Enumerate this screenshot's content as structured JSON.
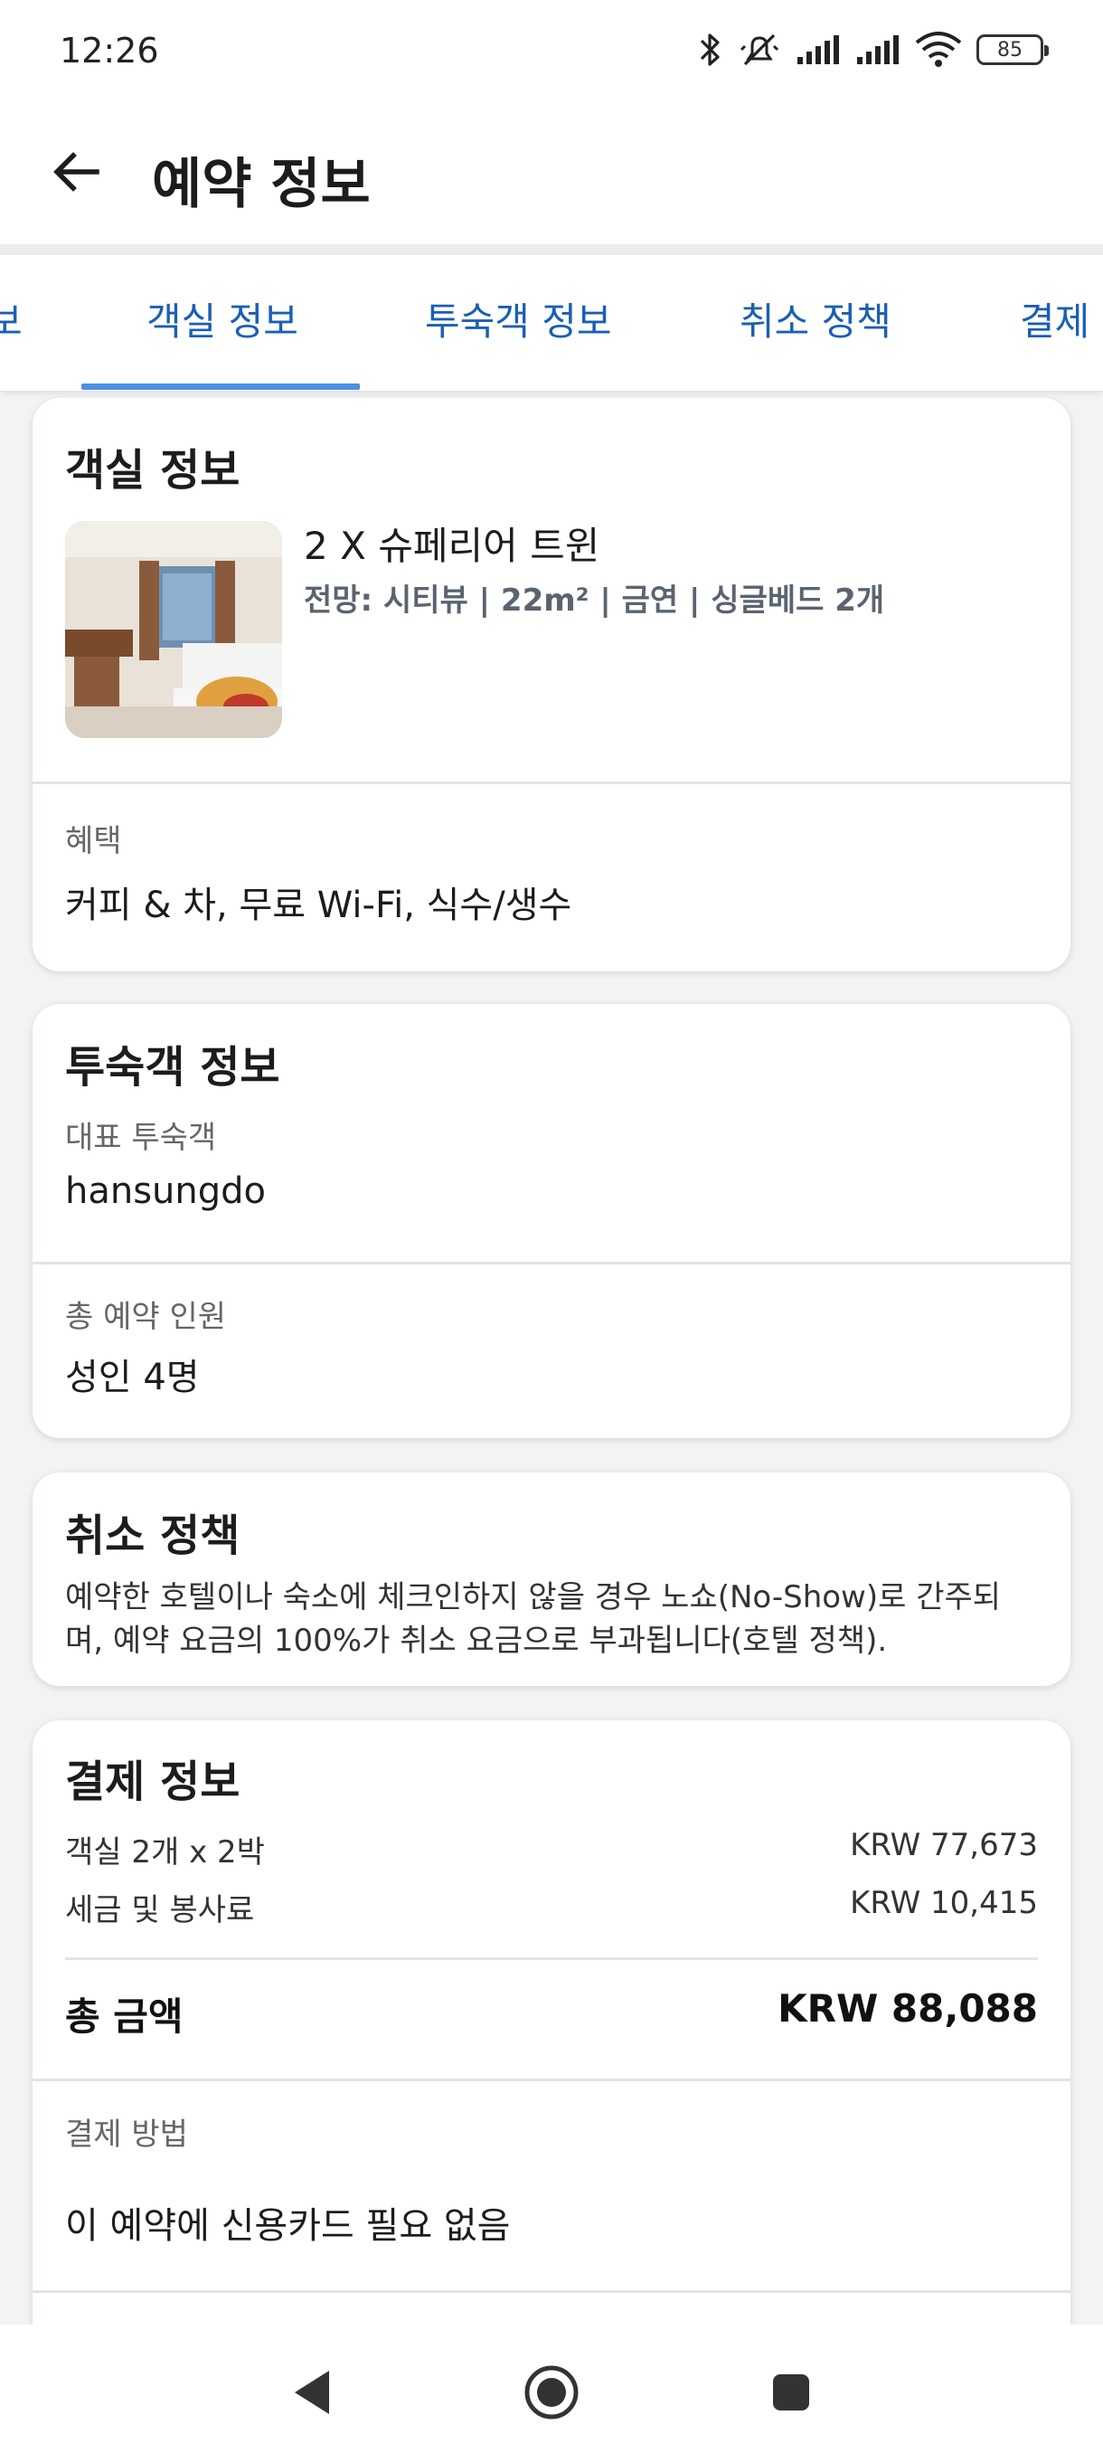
{
  "status_bar": {
    "time": "12:26",
    "battery": "85",
    "icons": [
      "bluetooth-icon",
      "mute-icon",
      "signal-icon",
      "signal-icon",
      "wifi-icon",
      "battery-icon"
    ]
  },
  "header": {
    "title": "예약 정보",
    "back_icon": "arrow-left-icon"
  },
  "tabs": [
    {
      "label": "보"
    },
    {
      "label": "객실 정보",
      "active": true
    },
    {
      "label": "투숙객 정보"
    },
    {
      "label": "취소 정책"
    },
    {
      "label": "결제 정"
    }
  ],
  "room": {
    "title": "객실 정보",
    "name": "2 X 슈페리어 트윈",
    "details": "전망: 시티뷰 | 22m² | 금연 | 싱글베드 2개",
    "benefits_label": "혜택",
    "benefits": "커피 & 차, 무료 Wi-Fi, 식수/생수"
  },
  "guest": {
    "title": "투숙객 정보",
    "lead_label": "대표 투숙객",
    "lead_value": "hansungdo",
    "count_label": "총 예약 인원",
    "count_value": "성인 4명"
  },
  "cancel": {
    "title": "취소 정책",
    "line1": "예약한 호텔이나 숙소에 체크인하지 않을 경우 노쇼(No-Show)로 간주되",
    "line2": "며, 예약 요금의 100%가 취소 요금으로 부과됩니다(호텔 정책)."
  },
  "payment": {
    "title": "결제 정보",
    "rows": [
      {
        "label": "객실 2개 x 2박",
        "value": "KRW 77,673"
      },
      {
        "label": "세금 및 봉사료",
        "value": "KRW 10,415"
      }
    ],
    "total_label": "총 금액",
    "total_value": "KRW 88,088",
    "method_label": "결제 방법",
    "method_value": "이 예약에 신용카드 필요 없음"
  },
  "colors": {
    "accent": "#1a5fb4",
    "indicator": "#4f8fe0",
    "background": "#f1f3f4"
  }
}
